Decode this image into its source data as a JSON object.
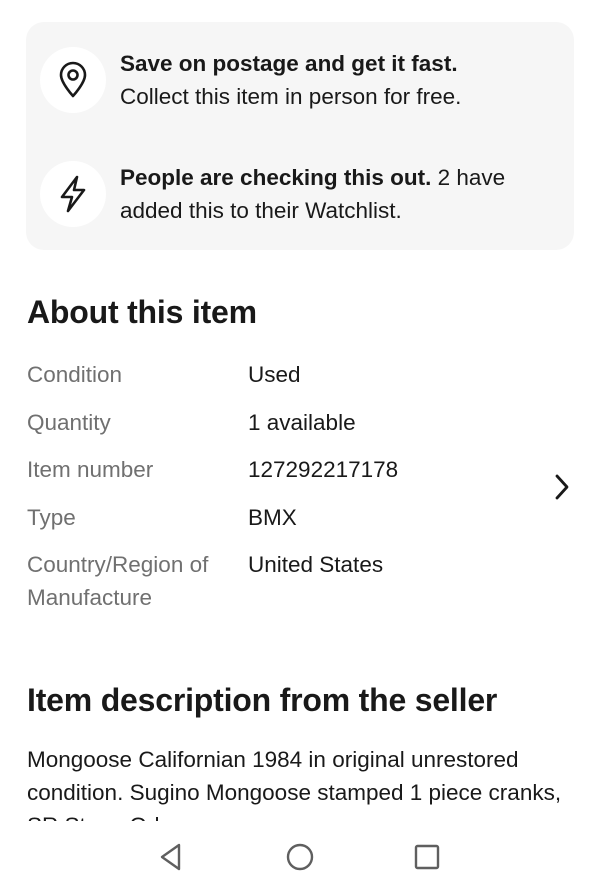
{
  "info_card": {
    "items": [
      {
        "icon": "location-pin-icon",
        "title": "Save on postage and get it fast.",
        "text": "Collect this item in person for free."
      },
      {
        "icon": "lightning-icon",
        "title": "People are checking this out.",
        "text": "2 have added this to their Watchlist."
      }
    ]
  },
  "about": {
    "heading": "About this item",
    "specs": [
      {
        "label": "Condition",
        "value": "Used"
      },
      {
        "label": "Quantity",
        "value": "1 available"
      },
      {
        "label": "Item number",
        "value": "127292217178"
      },
      {
        "label": "Type",
        "value": "BMX"
      },
      {
        "label": "Country/Region of Manufacture",
        "value": "United States"
      }
    ],
    "more_icon": "chevron-right-icon"
  },
  "description": {
    "heading": "Item description from the seller",
    "text": "Mongoose Californian 1984 in original unrestored condition. Sugino Mongoose stamped 1 piece cranks, SR Stem, Odyssey"
  },
  "nav_bar": {
    "back_icon": "back-triangle-icon",
    "home_icon": "home-circle-icon",
    "recents_icon": "recents-square-icon"
  }
}
